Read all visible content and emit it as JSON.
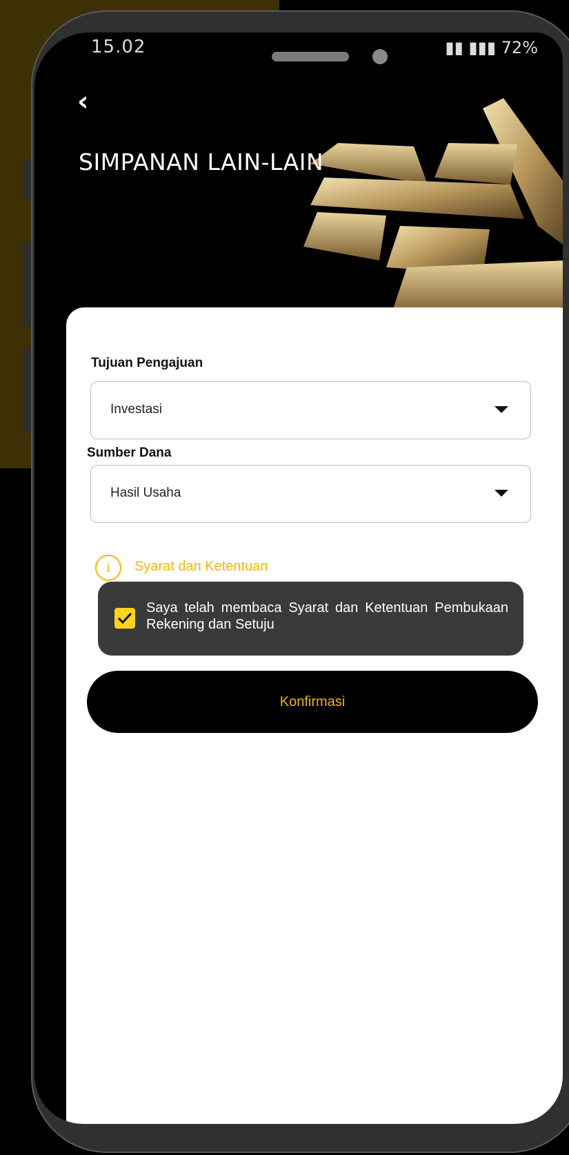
{
  "status_bar": {
    "time": "15.02",
    "battery": "72%"
  },
  "header": {
    "title": "SIMPANAN LAIN-LAIN",
    "back_icon": "chevron-left-icon"
  },
  "form": {
    "purpose": {
      "label": "Tujuan Pengajuan",
      "value": "Investasi"
    },
    "fund_source": {
      "label": "Sumber Dana",
      "value": "Hasil Usaha"
    },
    "terms_link": "Syarat dan Ketentuan",
    "agree_text": "Saya telah membaca Syarat dan Ketentuan Pembukaan Rekening dan Setuju",
    "agree_checked": true
  },
  "actions": {
    "confirm_label": "Konfirmasi"
  },
  "colors": {
    "accent": "#f2b705",
    "checkbox": "#ffd21f",
    "panel": "#3a3a3a"
  }
}
